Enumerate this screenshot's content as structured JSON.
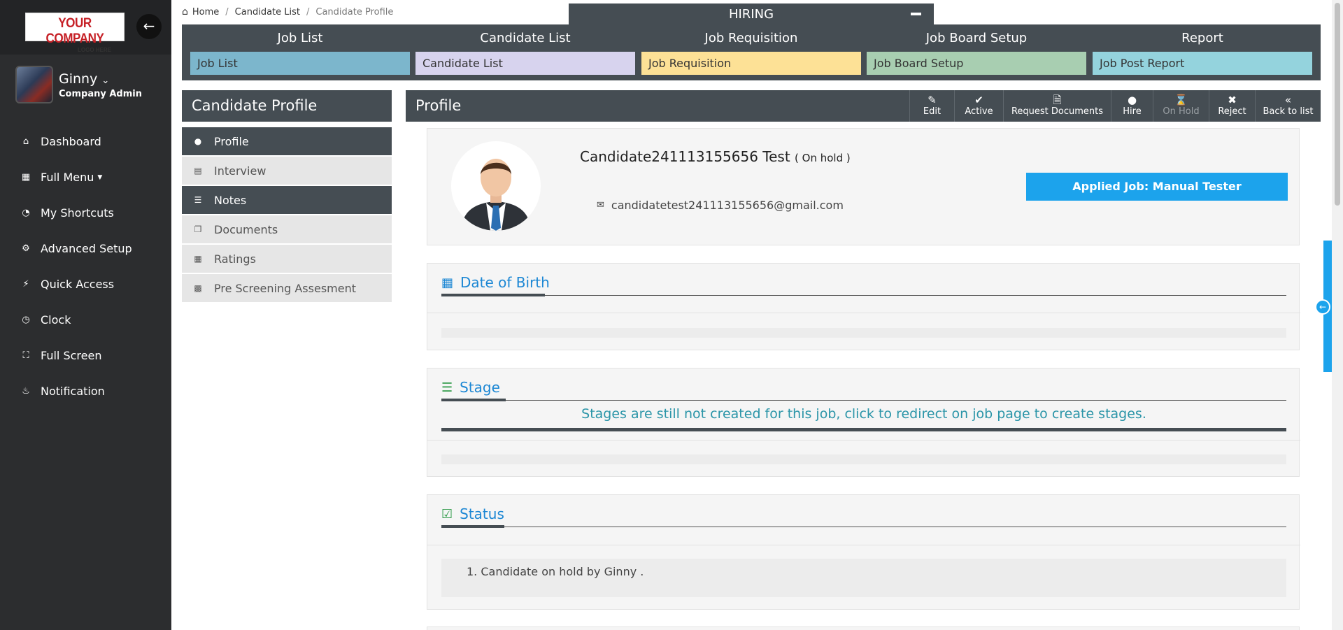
{
  "sidebar": {
    "logo_line1": "YOUR COMPANY",
    "logo_line2": "LOGO HERE",
    "user_name": "Ginny",
    "user_role": "Company Admin",
    "items": [
      {
        "label": "Dashboard",
        "icon": "home-icon"
      },
      {
        "label": "Full Menu",
        "icon": "grid-icon"
      },
      {
        "label": "My Shortcuts",
        "icon": "speedometer-icon"
      },
      {
        "label": "Advanced Setup",
        "icon": "gear-icon"
      },
      {
        "label": "Quick Access",
        "icon": "bolt-icon"
      },
      {
        "label": "Clock",
        "icon": "clock-icon"
      },
      {
        "label": "Full Screen",
        "icon": "expand-icon"
      },
      {
        "label": "Notification",
        "icon": "bell-icon"
      }
    ]
  },
  "breadcrumb": {
    "home": "Home",
    "list": "Candidate List",
    "current": "Candidate Profile"
  },
  "hiring_tab": "HIRING",
  "menu": [
    {
      "header": "Job List",
      "button": "Job List",
      "color": "#7cb6cc"
    },
    {
      "header": "Candidate List",
      "button": "Candidate List",
      "color": "#d7d3ee"
    },
    {
      "header": "Job Requisition",
      "button": "Job Requisition",
      "color": "#fde196"
    },
    {
      "header": "Job Board Setup",
      "button": "Job Board Setup",
      "color": "#a8ceb1"
    },
    {
      "header": "Report",
      "button": "Job Post Report",
      "color": "#94d3dd"
    }
  ],
  "candidate_panel": {
    "title": "Candidate Profile",
    "items": [
      {
        "label": "Profile",
        "icon": "user-icon"
      },
      {
        "label": "Interview",
        "icon": "interview-icon"
      },
      {
        "label": "Notes",
        "icon": "list-icon"
      },
      {
        "label": "Documents",
        "icon": "documents-icon"
      },
      {
        "label": "Ratings",
        "icon": "calendar-icon"
      },
      {
        "label": "Pre Screening Assesment",
        "icon": "newspaper-icon"
      }
    ]
  },
  "profile": {
    "title": "Profile",
    "toolbar": [
      {
        "label": "Edit",
        "icon": "pencil-icon"
      },
      {
        "label": "Active",
        "icon": "check-icon"
      },
      {
        "label": "Request Documents",
        "icon": "file-icon"
      },
      {
        "label": "Hire",
        "icon": "user-icon"
      },
      {
        "label": "On Hold",
        "icon": "hourglass-icon"
      },
      {
        "label": "Reject",
        "icon": "close-icon"
      },
      {
        "label": "Back to list",
        "icon": "double-chevron-left-icon"
      }
    ],
    "candidate_name": "Candidate241113155656 Test",
    "candidate_status": "( On hold )",
    "email": "candidatetest241113155656@gmail.com",
    "applied_job": "Applied Job: Manual Tester"
  },
  "sections": {
    "dob_title": "Date of Birth",
    "stage_title": "Stage",
    "stage_message": "Stages are still not created for this job, click to redirect on job page to create stages.",
    "status_title": "Status",
    "status_entry": "1. Candidate on hold by Ginny ."
  },
  "colors": {
    "sidebar": "#2c2d2f",
    "panel_header": "#454d53",
    "accent_blue": "#1ca3ec",
    "section_title": "#1c87d4",
    "stage_message": "#2b95a8"
  }
}
